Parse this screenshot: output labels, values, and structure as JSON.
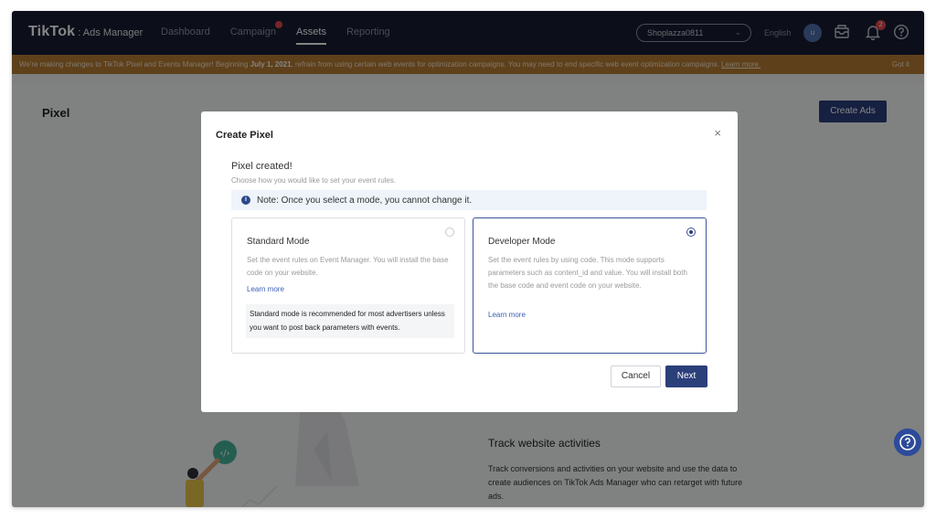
{
  "header": {
    "logo": "TikTok",
    "logo_suffix": ": Ads Manager",
    "nav": [
      {
        "label": "Dashboard"
      },
      {
        "label": "Campaign"
      },
      {
        "label": "Assets"
      },
      {
        "label": "Reporting"
      }
    ],
    "account": "Shoplazza0811",
    "language": "English",
    "avatar_initial": "u",
    "notification_count": "2"
  },
  "banner": {
    "text_before": "We're making changes to TikTok Pixel and Events Manager! Beginning ",
    "date": "July 1, 2021",
    "text_after": ", refrain from using certain web events for optimization campaigns. You may need to end specific web event optimization campaigns. ",
    "link": "Learn more.",
    "dismiss": "Got it"
  },
  "page": {
    "title": "Pixel",
    "create_button": "Create Ads",
    "track_title": "Track website activities",
    "track_desc": "Track conversions and activities on your website and use the data to create audiences on TikTok Ads Manager who can retarget with future ads."
  },
  "modal": {
    "title": "Create Pixel",
    "close": "×",
    "created_title": "Pixel created!",
    "created_sub": "Choose how you would like to set your event rules.",
    "note": "Note: Once you select a mode, you cannot change it.",
    "note_icon": "i",
    "standard": {
      "title": "Standard Mode",
      "desc": "Set the event rules on Event Manager. You will install the base code on your website.",
      "link": "Learn more",
      "recommendation": "Standard mode is recommended for most advertisers unless you want to post back parameters with events.",
      "selected": false
    },
    "developer": {
      "title": "Developer Mode",
      "desc": "Set the event rules by using code. This mode supports parameters such as content_id and value. You will install both the base code and event code on your website.",
      "link": "Learn more",
      "selected": true
    },
    "cancel": "Cancel",
    "next": "Next"
  },
  "colors": {
    "header_bg": "#171e33",
    "banner_bg": "#b57b33",
    "primary": "#2b3f7b",
    "link": "#3a5fb4"
  }
}
